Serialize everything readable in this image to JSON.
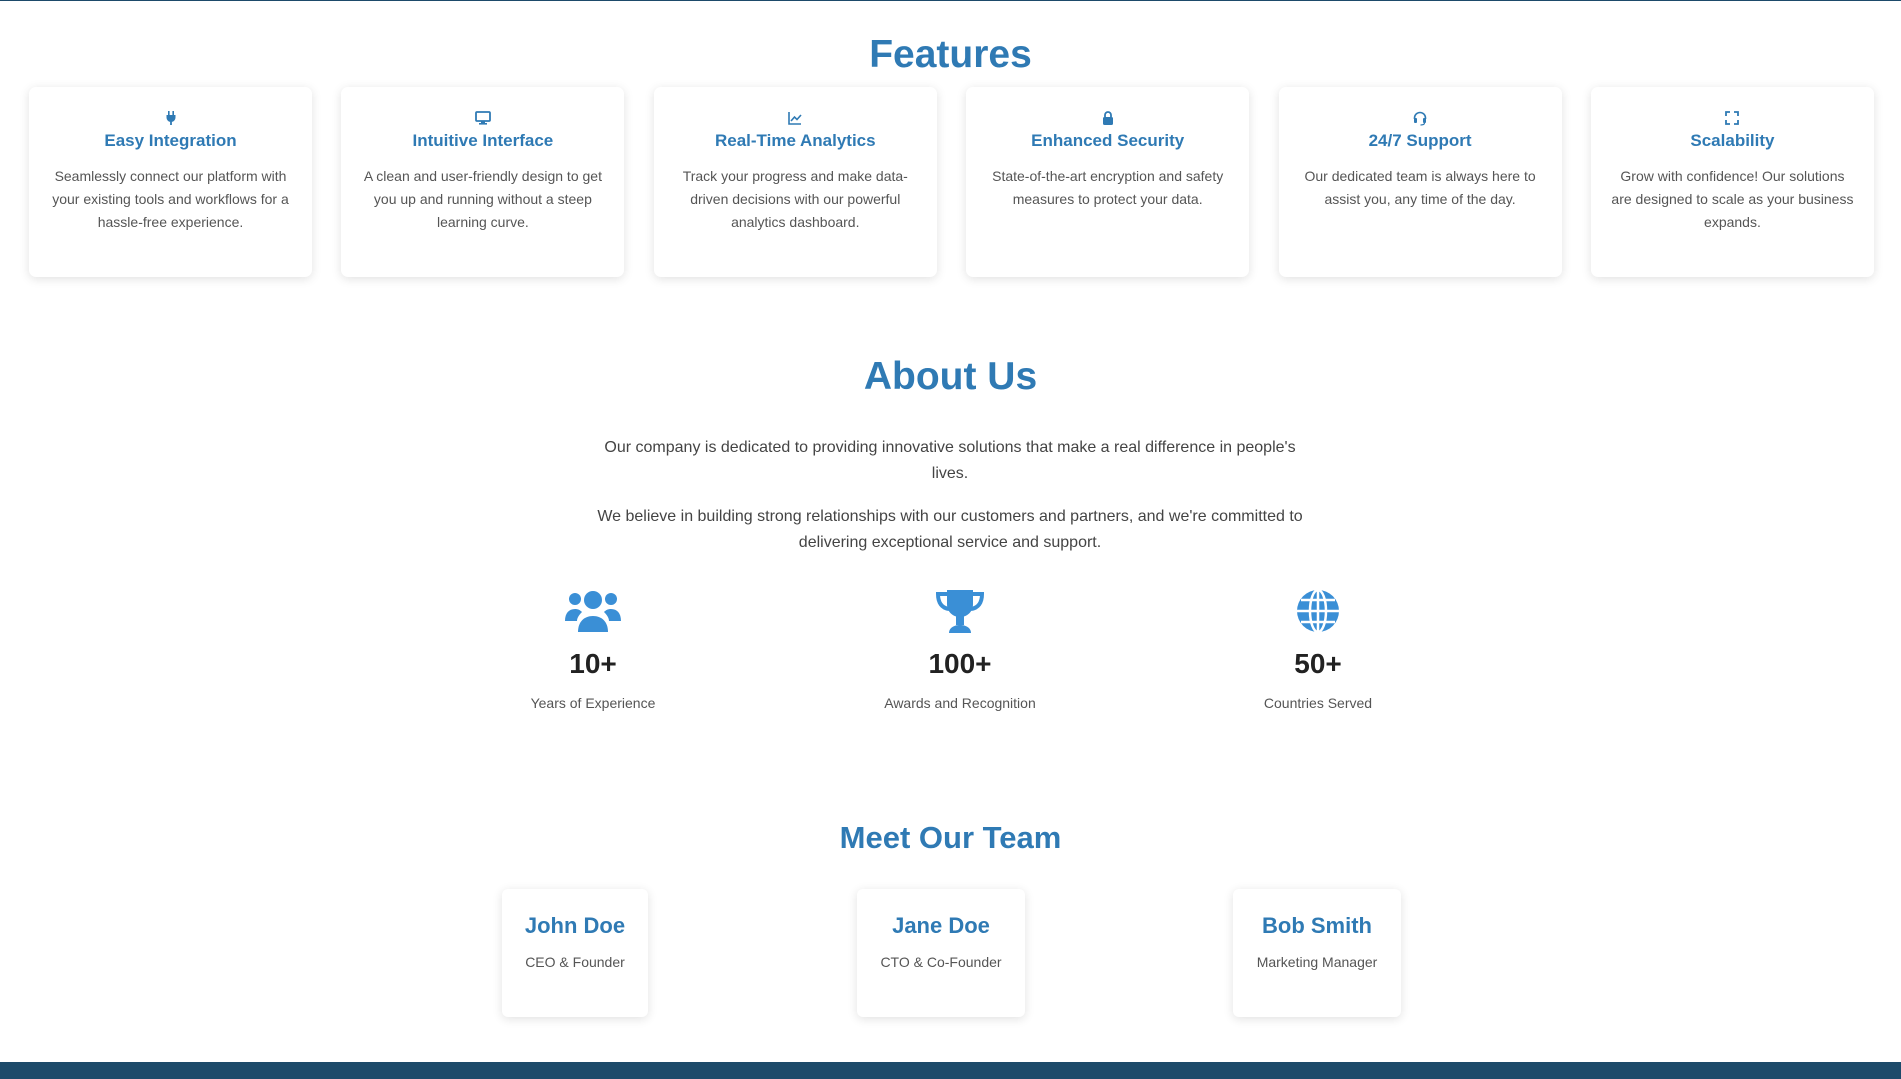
{
  "features": {
    "title": "Features",
    "items": [
      {
        "icon": "plug-icon",
        "title": "Easy Integration",
        "desc": "Seamlessly connect our platform with your existing tools and workflows for a hassle-free experience."
      },
      {
        "icon": "desktop-icon",
        "title": "Intuitive Interface",
        "desc": "A clean and user-friendly design to get you up and running without a steep learning curve."
      },
      {
        "icon": "chart-line-icon",
        "title": "Real-Time Analytics",
        "desc": "Track your progress and make data-driven decisions with our powerful analytics dashboard."
      },
      {
        "icon": "lock-icon",
        "title": "Enhanced Security",
        "desc": "State-of-the-art encryption and safety measures to protect your data."
      },
      {
        "icon": "headset-icon",
        "title": "24/7 Support",
        "desc": "Our dedicated team is always here to assist you, any time of the day."
      },
      {
        "icon": "expand-icon",
        "title": "Scalability",
        "desc": "Grow with confidence! Our solutions are designed to scale as your business expands."
      }
    ]
  },
  "about": {
    "title": "About Us",
    "p1": "Our company is dedicated to providing innovative solutions that make a real difference in people's lives.",
    "p2": "We believe in building strong relationships with our customers and partners, and we're committed to delivering exceptional service and support.",
    "stats": [
      {
        "icon": "users-icon",
        "value": "10+",
        "label": "Years of Experience"
      },
      {
        "icon": "trophy-icon",
        "value": "100+",
        "label": "Awards and Recognition"
      },
      {
        "icon": "globe-icon",
        "value": "50+",
        "label": "Countries Served"
      }
    ]
  },
  "team": {
    "title": "Meet Our Team",
    "members": [
      {
        "name": "John Doe",
        "role": "CEO & Founder"
      },
      {
        "name": "Jane Doe",
        "role": "CTO & Co-Founder"
      },
      {
        "name": "Bob Smith",
        "role": "Marketing Manager"
      }
    ]
  },
  "colors": {
    "accent": "#2f7ab4",
    "icon_blue": "#3a8fd6",
    "footer": "#1d4a6a"
  }
}
